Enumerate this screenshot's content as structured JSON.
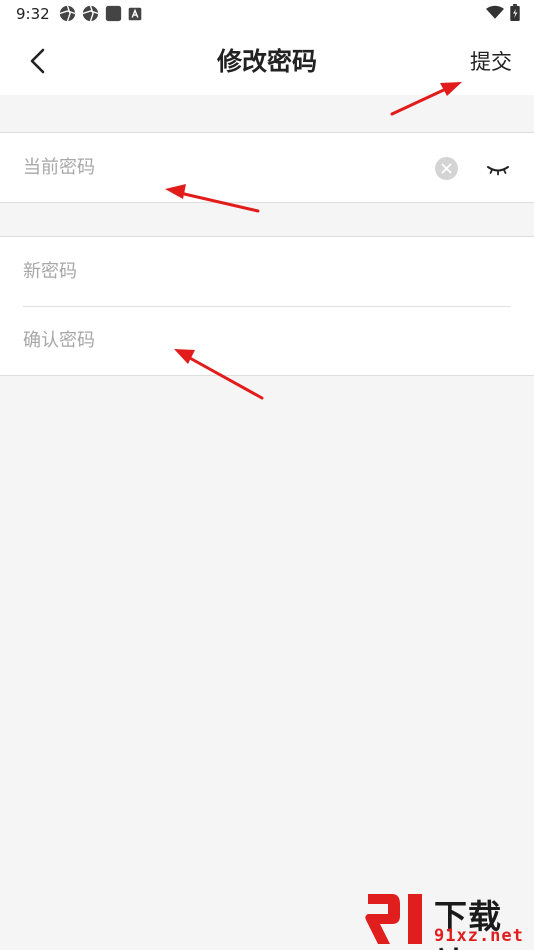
{
  "status_bar": {
    "time": "9:32",
    "left_icons": [
      "aperture-icon",
      "aperture-icon",
      "square-app-icon",
      "letter-a-icon"
    ],
    "right_icons": [
      "wifi-icon",
      "battery-charging-icon"
    ]
  },
  "nav": {
    "title": "修改密码",
    "back_icon": "chevron-left-icon",
    "submit_label": "提交"
  },
  "form": {
    "current_password": {
      "placeholder": "当前密码",
      "value": ""
    },
    "new_password": {
      "placeholder": "新密码",
      "value": ""
    },
    "confirm_password": {
      "placeholder": "确认密码",
      "value": ""
    }
  },
  "annotation": {
    "arrow_color": "#e21b1b"
  },
  "watermark": {
    "cn_text": "下载站",
    "url_text": "91xz.net",
    "accent": "#e01e1e"
  }
}
